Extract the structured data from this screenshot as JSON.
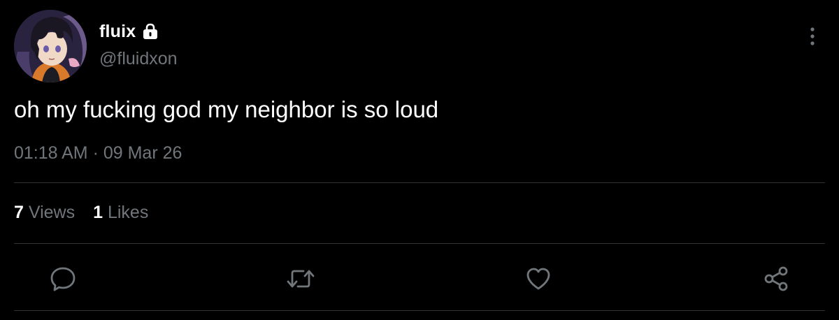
{
  "author": {
    "display_name": "fluix",
    "handle": "@fluidxon",
    "protected_icon": "lock-icon",
    "avatar": "avatar-anime-character"
  },
  "post": {
    "text": "oh my fucking god my neighbor is so loud",
    "timestamp": "01:18 AM · 09 Mar 26"
  },
  "stats": {
    "views_count": "7",
    "views_label": "Views",
    "likes_count": "1",
    "likes_label": "Likes"
  },
  "actions": [
    {
      "name": "reply",
      "icon": "speech-bubble-icon"
    },
    {
      "name": "repost",
      "icon": "repost-arrows-icon"
    },
    {
      "name": "like",
      "icon": "heart-icon"
    },
    {
      "name": "share",
      "icon": "share-nodes-icon"
    }
  ],
  "colors": {
    "background": "#000000",
    "primary_text": "#ffffff",
    "secondary_text": "#71767b",
    "divider": "#2f3336",
    "icon": "#71767b"
  }
}
